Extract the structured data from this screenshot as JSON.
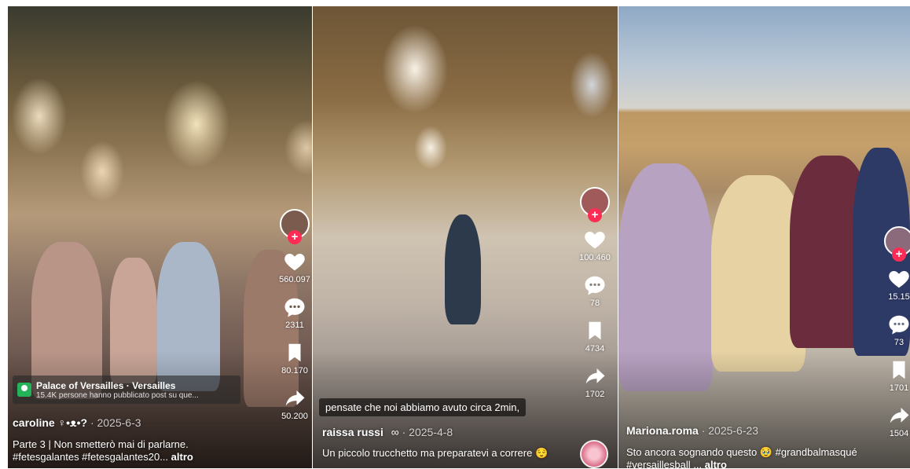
{
  "posts": [
    {
      "location": {
        "title": "Palace of Versailles · Versailles",
        "subtitle": "15.4K persone hanno pubblicato post su que..."
      },
      "username": "caroline ♀•ᴥ•?",
      "date": "· 2025-6-3",
      "caption": "Parte 3 | Non smetterò mai di parlarne. #fetesgalantes #fetesgalantes20...",
      "more": "altro",
      "likes": "560.097",
      "comments": "2311",
      "saves": "80.170",
      "shares": "50.200"
    },
    {
      "overlay_text": "pensate che noi abbiamo avuto circa 2min,",
      "username": "raissa russi",
      "badge": "∞",
      "date": "· 2025-4-8",
      "caption": "Un piccolo trucchetto ma preparatevi a correre 😌",
      "likes": "100.460",
      "comments": "78",
      "saves": "4734",
      "shares": "1702"
    },
    {
      "username": "Mariona.roma",
      "date": "· 2025-6-23",
      "caption": "Sto ancora sognando questo 🥹 #grandbalmasqué #versaillesball ...",
      "more": "altro",
      "likes": "15.15",
      "comments": "73",
      "saves": "1701",
      "shares": "1504"
    }
  ],
  "colors": {
    "follow": "#fe2c55",
    "location_icon": "#25b35a"
  },
  "icons": [
    "heart-icon",
    "comment-icon",
    "bookmark-icon",
    "share-icon",
    "plus-icon",
    "location-pin-icon"
  ]
}
